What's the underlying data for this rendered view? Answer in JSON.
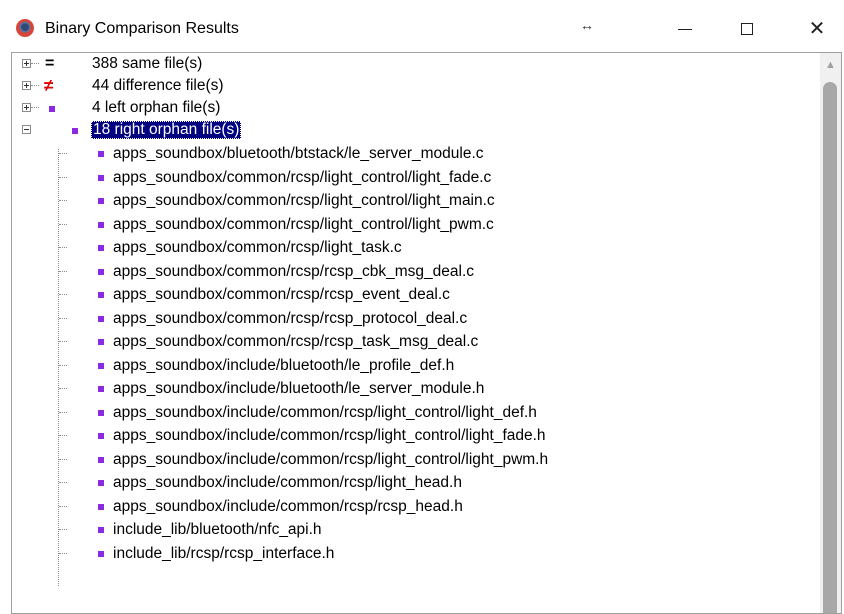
{
  "window": {
    "title": "Binary Comparison Results",
    "resize_glyph": "↔",
    "controls": {
      "minimize": "minimize-icon",
      "maximize": "maximize-icon",
      "close": "✕"
    }
  },
  "tree": {
    "groups": [
      {
        "label": "388 same file(s)",
        "glyph": "=",
        "kind": "same",
        "expander": "plus"
      },
      {
        "label": "44 difference file(s)",
        "glyph": "≠",
        "kind": "difference",
        "expander": "plus"
      },
      {
        "label": "4 left orphan file(s)",
        "glyph": "",
        "kind": "left-orphan",
        "expander": "plus"
      },
      {
        "label": "18 right orphan file(s)",
        "glyph": "",
        "kind": "right-orphan",
        "expander": "minus",
        "selected": true
      }
    ],
    "right_orphan_files": [
      "apps_soundbox/bluetooth/btstack/le_server_module.c",
      "apps_soundbox/common/rcsp/light_control/light_fade.c",
      "apps_soundbox/common/rcsp/light_control/light_main.c",
      "apps_soundbox/common/rcsp/light_control/light_pwm.c",
      "apps_soundbox/common/rcsp/light_task.c",
      "apps_soundbox/common/rcsp/rcsp_cbk_msg_deal.c",
      "apps_soundbox/common/rcsp/rcsp_event_deal.c",
      "apps_soundbox/common/rcsp/rcsp_protocol_deal.c",
      "apps_soundbox/common/rcsp/rcsp_task_msg_deal.c",
      "apps_soundbox/include/bluetooth/le_profile_def.h",
      "apps_soundbox/include/bluetooth/le_server_module.h",
      "apps_soundbox/include/common/rcsp/light_control/light_def.h",
      "apps_soundbox/include/common/rcsp/light_control/light_fade.h",
      "apps_soundbox/include/common/rcsp/light_control/light_pwm.h",
      "apps_soundbox/include/common/rcsp/light_head.h",
      "apps_soundbox/include/common/rcsp/rcsp_head.h",
      "include_lib/bluetooth/nfc_api.h",
      "include_lib/rcsp/rcsp_interface.h"
    ]
  },
  "colors": {
    "selection_bg": "#000080",
    "selection_fg": "#ffffff",
    "orphan_marker": "#8a2be2",
    "difference_glyph": "#e00000"
  }
}
